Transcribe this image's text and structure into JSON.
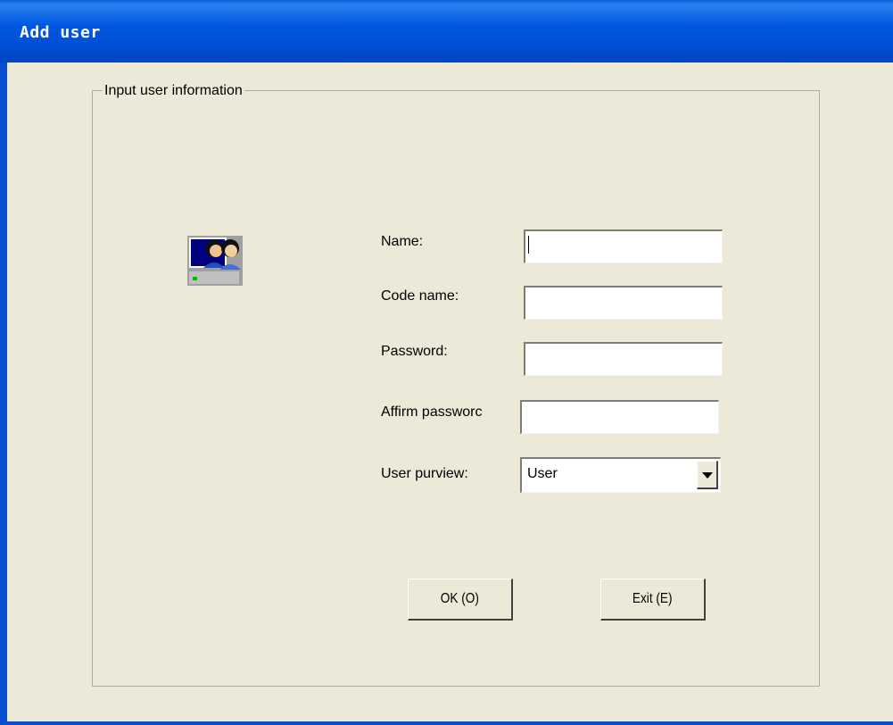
{
  "window": {
    "title": "Add user"
  },
  "group": {
    "label": "Input user information"
  },
  "icons": {
    "user_icon": "users-computer-icon"
  },
  "form": {
    "name_label": "Name:",
    "name_value": "",
    "code_name_label": "Code name:",
    "code_name_value": "",
    "password_label": "Password:",
    "password_value": "",
    "affirm_password_label": "Affirm passworc",
    "affirm_password_value": "",
    "user_purview_label": "User purview:",
    "user_purview_value": "User"
  },
  "buttons": {
    "ok_label": "OK (O)",
    "exit_label": "Exit (E)"
  },
  "colors": {
    "titlebar": "#0054e3",
    "background": "#ece9d8"
  }
}
